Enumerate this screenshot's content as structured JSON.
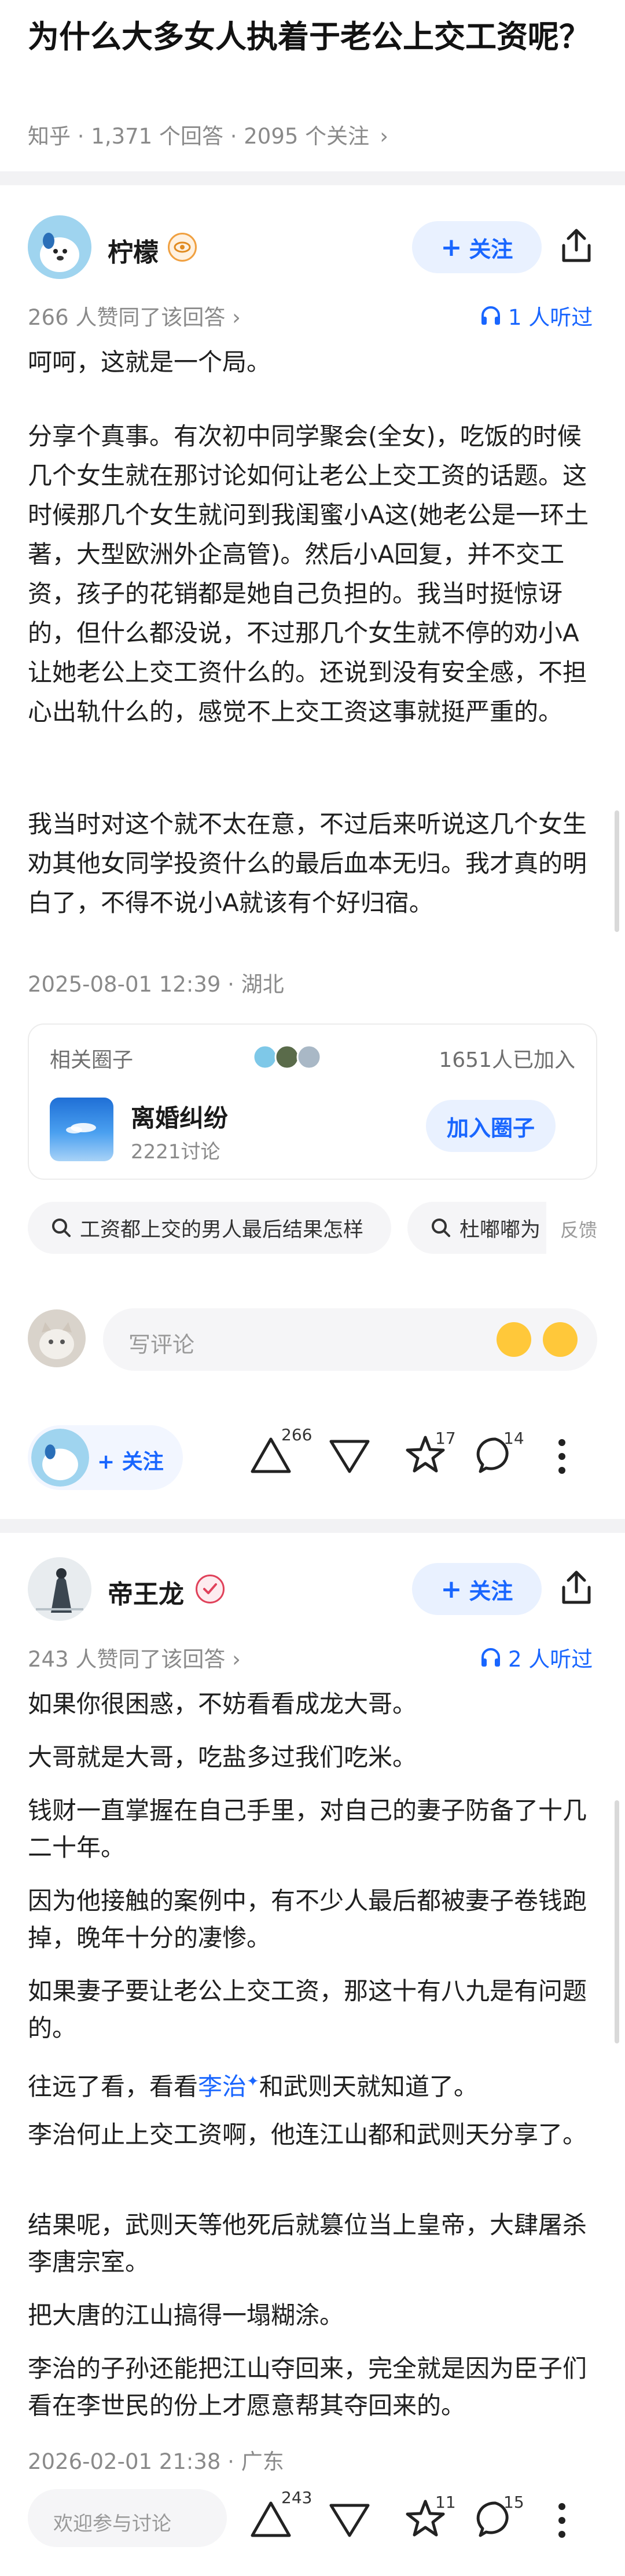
{
  "question": {
    "title": "为什么大多女人执着于老公上交工资呢？",
    "meta": "知乎 · 1,371 个回答 · 2095 个关注"
  },
  "answers": [
    {
      "author": "柠檬",
      "follow_label": "关注",
      "upvote_summary": "266 人赞同了该回答",
      "listeners": "1 人听过",
      "paragraphs": [
        "呵呵，这就是一个局。",
        "分享个真事。有次初中同学聚会(全女)，吃饭的时候几个女生就在那讨论如何让老公上交工资的话题。这时候那几个女生就问到我闺蜜小A这(她老公是一环土著，大型欧洲外企高管)。然后小A回复，并不交工资，孩子的花销都是她自己负担的。我当时挺惊讶的，但什么都没说，不过那几个女生就不停的劝小A让她老公上交工资什么的。还说到没有安全感，不担心出轨什么的，感觉不上交工资这事就挺严重的。",
        "我当时对这个就不太在意，不过后来听说这几个女生劝其他女同学投资什么的最后血本无归。我才真的明白了，不得不说小A就该有个好归宿。"
      ],
      "timestamp": "2025-08-01 12:39 · 湖北",
      "circle": {
        "label": "相关圈子",
        "joined": "1651人已加入",
        "name": "离婚纠纷",
        "discussions": "2221讨论",
        "join_label": "加入圈子"
      },
      "search_chips": [
        "工资都上交的男人最后结果怎样",
        "杜嘟嘟为"
      ],
      "feedback": "反馈",
      "comment_placeholder": "写评论",
      "actions": {
        "upvotes": "266",
        "favorites": "17",
        "comments": "14",
        "follow_label": "关注"
      }
    },
    {
      "author": "帝王龙",
      "follow_label": "关注",
      "upvote_summary": "243 人赞同了该回答",
      "listeners": "2 人听过",
      "paragraphs": [
        "如果你很困惑，不妨看看成龙大哥。",
        "大哥就是大哥，吃盐多过我们吃米。",
        "钱财一直掌握在自己手里，对自己的妻子防备了十几二十年。",
        "因为他接触的案例中，有不少人最后都被妻子卷钱跑掉，晚年十分的凄惨。",
        "如果妻子要让老公上交工资，那这十有八九是有问题的。",
        "和武则天就知道了。",
        "李治何止上交工资啊，他连江山都和武则天分享了。",
        "结果呢，武则天等他死后就篡位当上皇帝，大肆屠杀李唐宗室。",
        "把大唐的江山搞得一塌糊涂。",
        "李治的子孙还能把江山夺回来，完全就是因为臣子们看在李世民的份上才愿意帮其夺回来的。"
      ],
      "para6_prefix": "往远了看，看看",
      "para6_link": "李治",
      "timestamp": "2026-02-01 21:38 · 广东",
      "bottom_input": "欢迎参与讨论",
      "actions": {
        "upvotes": "243",
        "favorites": "11",
        "comments": "15"
      }
    }
  ]
}
